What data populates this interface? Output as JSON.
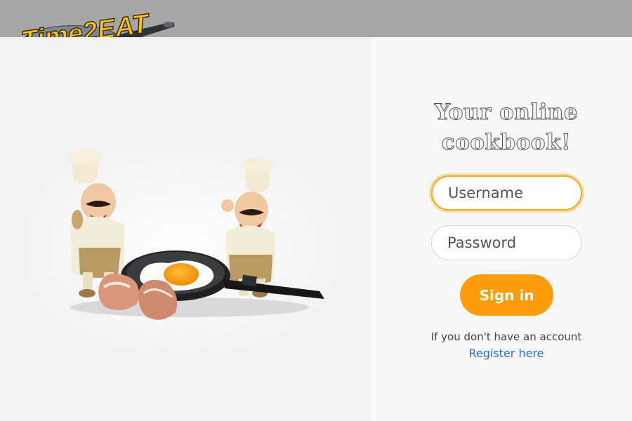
{
  "header": {
    "logo_text": "Time2EAT",
    "background_color": "#a6a6a6"
  },
  "hero": {
    "description_icon": "chef-figurines-frying-egg-illustration"
  },
  "login": {
    "heading_line1": "Your online",
    "heading_line2": "cookbook!",
    "username_placeholder": "Username",
    "password_placeholder": "Password",
    "signin_label": "Sign in",
    "no_account_text": "If you don't have an account",
    "register_label": "Register here",
    "accent_color": "#ff9c0b",
    "link_color": "#2a6ae0"
  }
}
